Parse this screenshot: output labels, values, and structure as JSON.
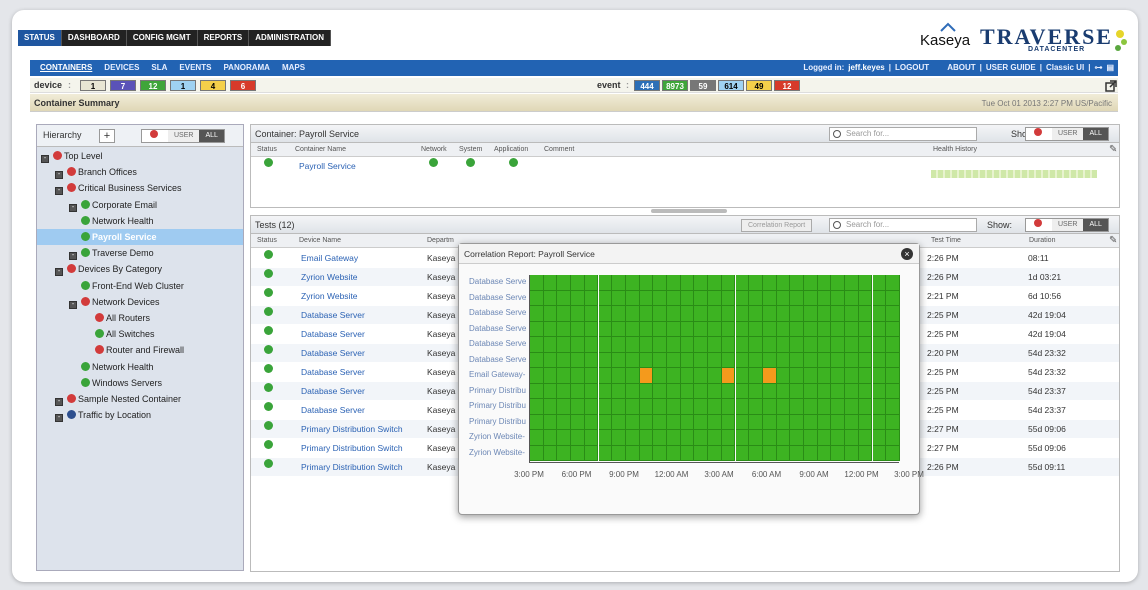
{
  "tabs": [
    {
      "label": "STATUS",
      "active": true
    },
    {
      "label": "DASHBOARD",
      "active": false
    },
    {
      "label": "CONFIG MGMT",
      "active": false
    },
    {
      "label": "REPORTS",
      "active": false
    },
    {
      "label": "ADMINISTRATION",
      "active": false
    }
  ],
  "subtabs": [
    {
      "label": "CONTAINERS",
      "active": true
    },
    {
      "label": "DEVICES"
    },
    {
      "label": "SLA"
    },
    {
      "label": "EVENTS"
    },
    {
      "label": "PANORAMA"
    },
    {
      "label": "MAPS"
    }
  ],
  "logo": {
    "kaseya": "Kaseya",
    "traverse": "TRAVERSE",
    "datacenter": "DATACENTER"
  },
  "userbar": {
    "logged_in": "Logged in:",
    "user": "jeff.keyes",
    "sep": "|",
    "logout": "LOGOUT",
    "about": "ABOUT",
    "user_guide": "USER GUIDE",
    "classic": "Classic UI"
  },
  "device_counts": {
    "label": "device",
    "values": [
      "1",
      "7",
      "12",
      "1",
      "4",
      "6"
    ]
  },
  "event_counts": {
    "label": "event",
    "values": [
      "444",
      "8973",
      "59",
      "614",
      "49",
      "12"
    ]
  },
  "summary": {
    "title": "Container Summary",
    "datetime": "Tue Oct 01 2013 2:27 PM US/Pacific"
  },
  "hierarchy": {
    "label": "Hierarchy",
    "add": "+",
    "user": "USER",
    "all": "ALL",
    "items": [
      {
        "label": "Top Level",
        "status": "r",
        "level": 0,
        "expand": true
      },
      {
        "label": "Branch Offices",
        "status": "r",
        "level": 1,
        "expand": true
      },
      {
        "label": "Critical Business Services",
        "status": "r",
        "level": 1,
        "expand": true
      },
      {
        "label": "Corporate Email",
        "status": "g",
        "level": 2,
        "expand": true
      },
      {
        "label": "Network Health",
        "status": "g",
        "level": 2,
        "expand": false
      },
      {
        "label": "Payroll Service",
        "status": "g",
        "level": 2,
        "expand": false,
        "selected": true
      },
      {
        "label": "Traverse Demo",
        "status": "g",
        "level": 2,
        "expand": true
      },
      {
        "label": "Devices By Category",
        "status": "r",
        "level": 1,
        "expand": true
      },
      {
        "label": "Front-End Web Cluster",
        "status": "g",
        "level": 2,
        "expand": false
      },
      {
        "label": "Network Devices",
        "status": "r",
        "level": 2,
        "expand": true
      },
      {
        "label": "All Routers",
        "status": "r",
        "level": 3,
        "expand": false
      },
      {
        "label": "All Switches",
        "status": "g",
        "level": 3,
        "expand": false
      },
      {
        "label": "Router and Firewall",
        "status": "r",
        "level": 3,
        "expand": false
      },
      {
        "label": "Network Health",
        "status": "g",
        "level": 2,
        "expand": false
      },
      {
        "label": "Windows Servers",
        "status": "g",
        "level": 2,
        "expand": false
      },
      {
        "label": "Sample Nested Container",
        "status": "r",
        "level": 1,
        "expand": true
      },
      {
        "label": "Traffic by Location",
        "status": "b",
        "level": 1,
        "expand": true
      }
    ]
  },
  "container_panel": {
    "title": "Container: Payroll Service",
    "search_placeholder": "Search for...",
    "show": "Show:",
    "user": "USER",
    "all": "ALL",
    "columns": [
      "Status",
      "Container Name",
      "Network",
      "System",
      "Application",
      "Comment",
      "Health History"
    ],
    "row": {
      "name": "Payroll Service"
    }
  },
  "tests_panel": {
    "title": "Tests (12)",
    "corr_button": "Correlation Report",
    "search_placeholder": "Search for...",
    "show": "Show:",
    "user": "USER",
    "all": "ALL",
    "columns": [
      "Status",
      "Device Name",
      "Departm",
      "Test Time",
      "Duration"
    ],
    "rows": [
      {
        "device": "Email Gateway",
        "dept": "Kaseya D",
        "time": "2:26 PM",
        "duration": "08:11"
      },
      {
        "device": "Zyrion Website",
        "dept": "Kaseya D",
        "time": "2:26 PM",
        "duration": "1d 03:21"
      },
      {
        "device": "Zyrion Website",
        "dept": "Kaseya D",
        "time": "2:21 PM",
        "duration": "6d 10:56"
      },
      {
        "device": "Database Server",
        "dept": "Kaseya D",
        "time": "2:25 PM",
        "duration": "42d 19:04"
      },
      {
        "device": "Database Server",
        "dept": "Kaseya D",
        "time": "2:25 PM",
        "duration": "42d 19:04"
      },
      {
        "device": "Database Server",
        "dept": "Kaseya D",
        "time": "2:20 PM",
        "duration": "54d 23:32"
      },
      {
        "device": "Database Server",
        "dept": "Kaseya D",
        "time": "2:25 PM",
        "duration": "54d 23:32"
      },
      {
        "device": "Database Server",
        "dept": "Kaseya D",
        "time": "2:25 PM",
        "duration": "54d 23:37"
      },
      {
        "device": "Database Server",
        "dept": "Kaseya D",
        "time": "2:25 PM",
        "duration": "54d 23:37"
      },
      {
        "device": "Primary Distribution Switch",
        "dept": "Kaseya D",
        "time": "2:27 PM",
        "duration": "55d 09:06"
      },
      {
        "device": "Primary Distribution Switch",
        "dept": "Kaseya D",
        "time": "2:27 PM",
        "duration": "55d 09:06"
      },
      {
        "device": "Primary Distribution Switch",
        "dept": "Kaseya D",
        "time": "2:26 PM",
        "duration": "55d 09:11"
      }
    ]
  },
  "correlation": {
    "title": "Correlation Report: Payroll Service",
    "close": "×",
    "ylabels": [
      "Database Serve",
      "Database Serve",
      "Database Serve",
      "Database Serve",
      "Database Serve",
      "Database Serve",
      "Email Gateway-",
      "Primary Distribu",
      "Primary Distribu",
      "Primary Distribu",
      "Zyrion Website-",
      "Zyrion Website-"
    ],
    "xlabels": [
      "3:00 PM",
      "6:00 PM",
      "9:00 PM",
      "12:00 AM",
      "3:00 AM",
      "6:00 AM",
      "9:00 AM",
      "12:00 PM",
      "3:00 PM"
    ],
    "cols": 27,
    "orange_cells": [
      [
        6,
        8
      ],
      [
        6,
        14
      ],
      [
        6,
        17
      ]
    ],
    "colors": {
      "ok": "#3db322",
      "warn": "#f49a1c"
    }
  }
}
